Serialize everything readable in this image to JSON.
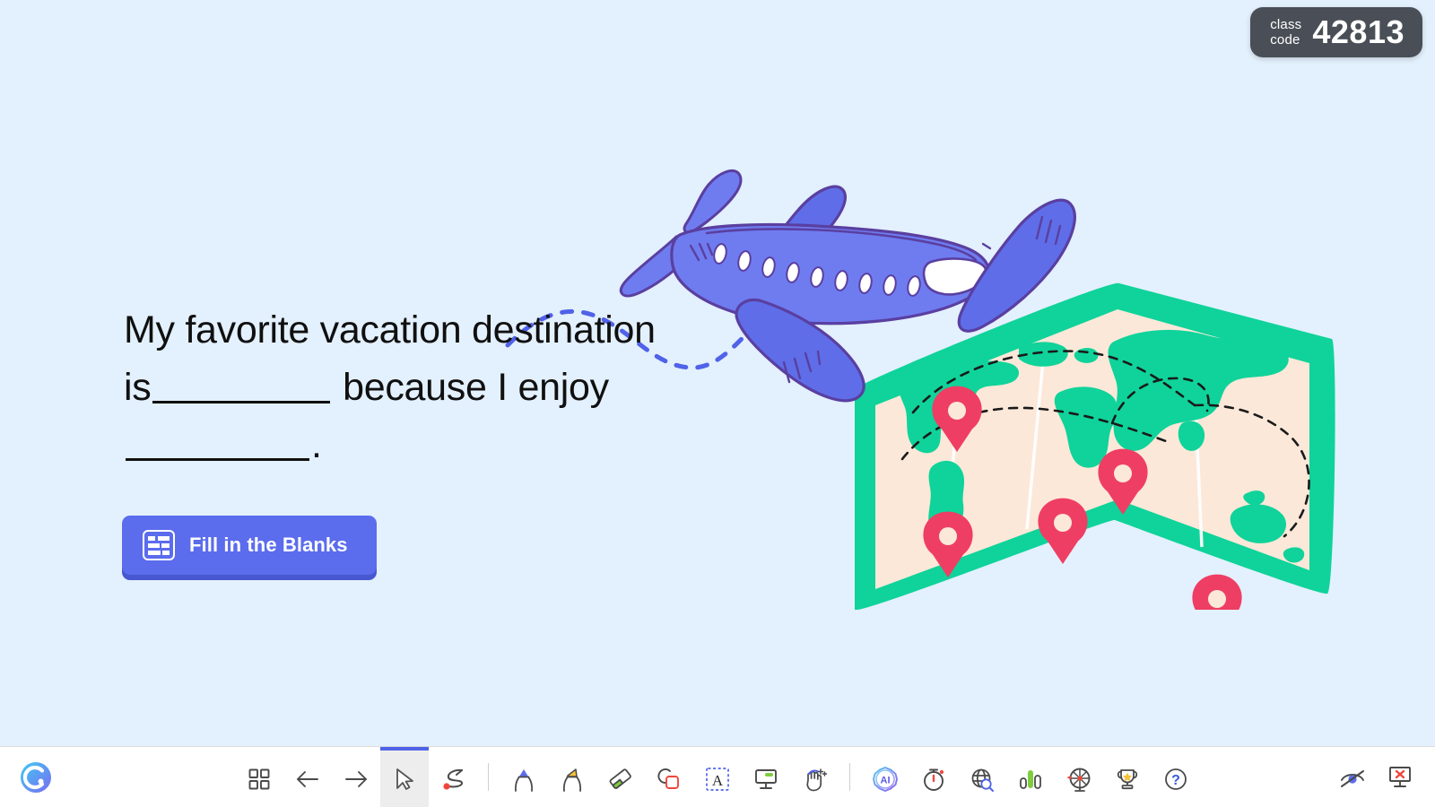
{
  "class_code": {
    "label_line1": "class",
    "label_line2": "code",
    "value": "42813"
  },
  "slide": {
    "text_part1": "My favorite vacation destination is",
    "text_part2": "because I enjoy",
    "text_part3": ".",
    "full_text": "My favorite vacation destination is ________ because I enjoy ________.",
    "background_color": "#e3f0fd"
  },
  "activity_button": {
    "label": "Fill in the Blanks",
    "icon": "fill-in-the-blanks-icon",
    "color": "#5b6ced",
    "shadow_color": "#4757cf"
  },
  "illustration": {
    "name": "airplane-and-world-map",
    "plane_color": "#6f7cf0",
    "plane_outline": "#5a3fa0",
    "map_border_color": "#0fd39a",
    "map_paper_color": "#fce8d8",
    "map_pin_color": "#ef3e63",
    "trail_color": "#4f62e8",
    "pin_count": 5
  },
  "toolbar": {
    "logo": "classpoint-logo",
    "tools": [
      {
        "name": "slide-grid-view",
        "icon": "grid-icon",
        "active": false
      },
      {
        "name": "previous-slide",
        "icon": "arrow-left-icon",
        "active": false
      },
      {
        "name": "next-slide",
        "icon": "arrow-right-icon",
        "active": false
      },
      {
        "name": "select-cursor",
        "icon": "cursor-icon",
        "active": true
      },
      {
        "name": "laser-pointer",
        "icon": "laser-pointer-icon",
        "active": false
      },
      {
        "name": "pen",
        "icon": "pen-icon",
        "active": false
      },
      {
        "name": "highlighter",
        "icon": "highlighter-icon",
        "active": false
      },
      {
        "name": "eraser",
        "icon": "eraser-icon",
        "active": false
      },
      {
        "name": "shapes",
        "icon": "shapes-icon",
        "active": false
      },
      {
        "name": "text-box",
        "icon": "text-box-icon",
        "active": false
      },
      {
        "name": "whiteboard",
        "icon": "whiteboard-icon",
        "active": false
      },
      {
        "name": "drag-move",
        "icon": "drag-hand-icon",
        "active": false
      },
      {
        "name": "ai-assistant",
        "icon": "ai-icon",
        "active": false
      },
      {
        "name": "timer",
        "icon": "timer-icon",
        "active": false
      },
      {
        "name": "embedded-browser",
        "icon": "globe-search-icon",
        "active": false
      },
      {
        "name": "quick-poll",
        "icon": "bar-chart-icon",
        "active": false
      },
      {
        "name": "name-picker",
        "icon": "spinner-wheel-icon",
        "active": false
      },
      {
        "name": "leaderboard",
        "icon": "trophy-icon",
        "active": false
      },
      {
        "name": "help",
        "icon": "question-mark-icon",
        "active": false
      }
    ],
    "right_tools": [
      {
        "name": "hide-annotations",
        "icon": "eye-off-icon"
      },
      {
        "name": "exit-presentation",
        "icon": "exit-slideshow-icon"
      }
    ]
  }
}
